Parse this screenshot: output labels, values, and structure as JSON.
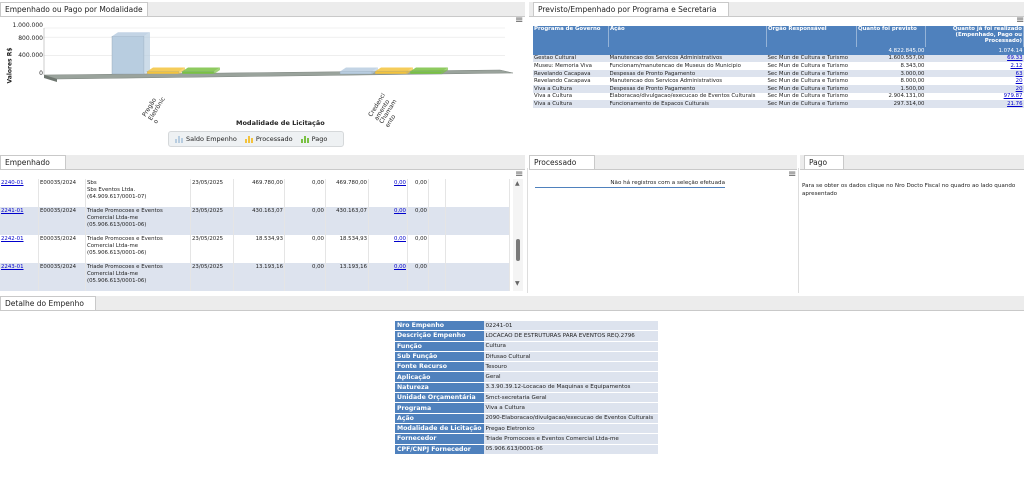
{
  "chart_panel": {
    "tab": "Empenhado ou Pago por Modalidade",
    "chart_data": {
      "type": "bar",
      "title": "",
      "xlabel": "Modalidade de Licitação",
      "ylabel": "Valores R$",
      "yticks": [
        "1.000.000",
        "800.000",
        "400.000",
        "0"
      ],
      "ylim": [
        0,
        1000000
      ],
      "categories": [
        "Pregão Eletrônico",
        "Credenciamento Chamamento"
      ],
      "category_labels": [
        "Pregão\nEletrônic\no",
        "Credenci\namento\nChamam\nento"
      ],
      "series": [
        {
          "name": "Saldo Empenho",
          "color": "#b8cde0",
          "values": [
            820000,
            0
          ]
        },
        {
          "name": "Processado",
          "color": "#f3c33d",
          "values": [
            0,
            0
          ]
        },
        {
          "name": "Pago",
          "color": "#7ac143",
          "values": [
            0,
            0
          ]
        }
      ],
      "legend_position": "bottom"
    }
  },
  "programa_panel": {
    "tab": "Previsto/Empenhado por Programa e Secretaria",
    "headers": [
      "Programa de Governo",
      "Ação",
      "Órgão Responsável",
      "Quanto foi previsto",
      "Quanto já foi realizado (Empenhado, Pago ou Processado)"
    ],
    "totals": {
      "previsto": "4.822.845,00",
      "realizado": "1.074.14"
    },
    "rows": [
      {
        "programa": "Gestao Cultural",
        "acao": "Manutencao dos Servicos Administrativos",
        "orgao": "Sec Mun de Cultura e Turismo",
        "previsto": "1.600.557,00",
        "realizado": "69.33"
      },
      {
        "programa": "Museu: Memoria Viva",
        "acao": "Funcionam/manutencao de Museus do Municipio",
        "orgao": "Sec Mun de Cultura e Turismo",
        "previsto": "8.343,00",
        "realizado": "2.12"
      },
      {
        "programa": "Revelando Cacapava",
        "acao": "Despesas de Pronto Pagamento",
        "orgao": "Sec Mun de Cultura e Turismo",
        "previsto": "3.000,00",
        "realizado": "63"
      },
      {
        "programa": "Revelando Cacapava",
        "acao": "Manutencao dos Servicos Administrativos",
        "orgao": "Sec Mun de Cultura e Turismo",
        "previsto": "8.000,00",
        "realizado": "20"
      },
      {
        "programa": "Viva a Cultura",
        "acao": "Despesas de Pronto Pagamento",
        "orgao": "Sec Mun de Cultura e Turismo",
        "previsto": "1.500,00",
        "realizado": "20"
      },
      {
        "programa": "Viva a Cultura",
        "acao": "Elaboracao/divulgacao/execucao de Eventos Culturais",
        "orgao": "Sec Mun de Cultura e Turismo",
        "previsto": "2.904.131,00",
        "realizado": "979.87"
      },
      {
        "programa": "Viva a Cultura",
        "acao": "Funcionamento de Espacos Culturais",
        "orgao": "Sec Mun de Cultura e Turismo",
        "previsto": "297.314,00",
        "realizado": "21.76"
      }
    ]
  },
  "empenhado_panel": {
    "tab": "Empenhado",
    "rows": [
      {
        "nro": "2240-01",
        "proc": "E00035/2024",
        "fornecedor": "Sbs",
        "fornecedor2": "Sbs Eventos Ltda.",
        "cnpj": "(64.909.617/0001-07)",
        "data": "23/05/2025",
        "valor": "469.780,00",
        "anulado": "0,00",
        "saldo": "469.780,00",
        "processado": "0,00",
        "pago": "0,00"
      },
      {
        "nro": "2241-01",
        "proc": "E00035/2024",
        "fornecedor": "Triade Promocoes e Eventos",
        "fornecedor2": "Comercial Ltda-me",
        "cnpj": "(05.906.613/0001-06)",
        "data": "23/05/2025",
        "valor": "430.163,07",
        "anulado": "0,00",
        "saldo": "430.163,07",
        "processado": "0,00",
        "pago": "0,00"
      },
      {
        "nro": "2242-01",
        "proc": "E00035/2024",
        "fornecedor": "Triade Promocoes e Eventos",
        "fornecedor2": "Comercial Ltda-me",
        "cnpj": "(05.906.613/0001-06)",
        "data": "23/05/2025",
        "valor": "18.534,93",
        "anulado": "0,00",
        "saldo": "18.534,93",
        "processado": "0,00",
        "pago": "0,00"
      },
      {
        "nro": "2243-01",
        "proc": "E00035/2024",
        "fornecedor": "Triade Promocoes e Eventos",
        "fornecedor2": "Comercial Ltda-me",
        "cnpj": "(05.906.613/0001-06)",
        "data": "23/05/2025",
        "valor": "13.193,16",
        "anulado": "0,00",
        "saldo": "13.193,16",
        "processado": "0,00",
        "pago": "0,00"
      }
    ]
  },
  "processado_panel": {
    "tab": "Processado",
    "empty_message": "Não há registros com a seleção efetuada"
  },
  "pago_panel": {
    "tab": "Pago",
    "message": "Para se obter os dados clique no Nro Docto Fiscal no quadro ao lado quando apresentado"
  },
  "detalhe_panel": {
    "tab": "Detalhe do Empenho",
    "fields": [
      {
        "label": "Nro Empenho",
        "value": "02241-01"
      },
      {
        "label": "Descrição Empenho",
        "value": "LOCACAO DE ESTRUTURAS PARA EVENTOS REQ.2796"
      },
      {
        "label": "Função",
        "value": "Cultura"
      },
      {
        "label": "Sub Função",
        "value": "Difusao Cultural"
      },
      {
        "label": "Fonte Recurso",
        "value": "Tesouro"
      },
      {
        "label": "Aplicação",
        "value": "Geral"
      },
      {
        "label": "Natureza",
        "value": "3.3.90.39.12-Locacao de Maquinas e Equipamentos"
      },
      {
        "label": "Unidade Orçamentária",
        "value": "Smct-secretaria Geral"
      },
      {
        "label": "Programa",
        "value": "Viva a Cultura"
      },
      {
        "label": "Ação",
        "value": "2090-Elaboracao/divulgacao/execucao de Eventos Culturais"
      },
      {
        "label": "Modalidade de Licitação",
        "value": "Pregao Eletronico"
      },
      {
        "label": "Fornecedor",
        "value": "Triade Promocoes e Eventos Comercial Ltda-me"
      },
      {
        "label": "CPF/CNPJ Fornecedor",
        "value": "05.906.613/0001-06"
      }
    ]
  }
}
